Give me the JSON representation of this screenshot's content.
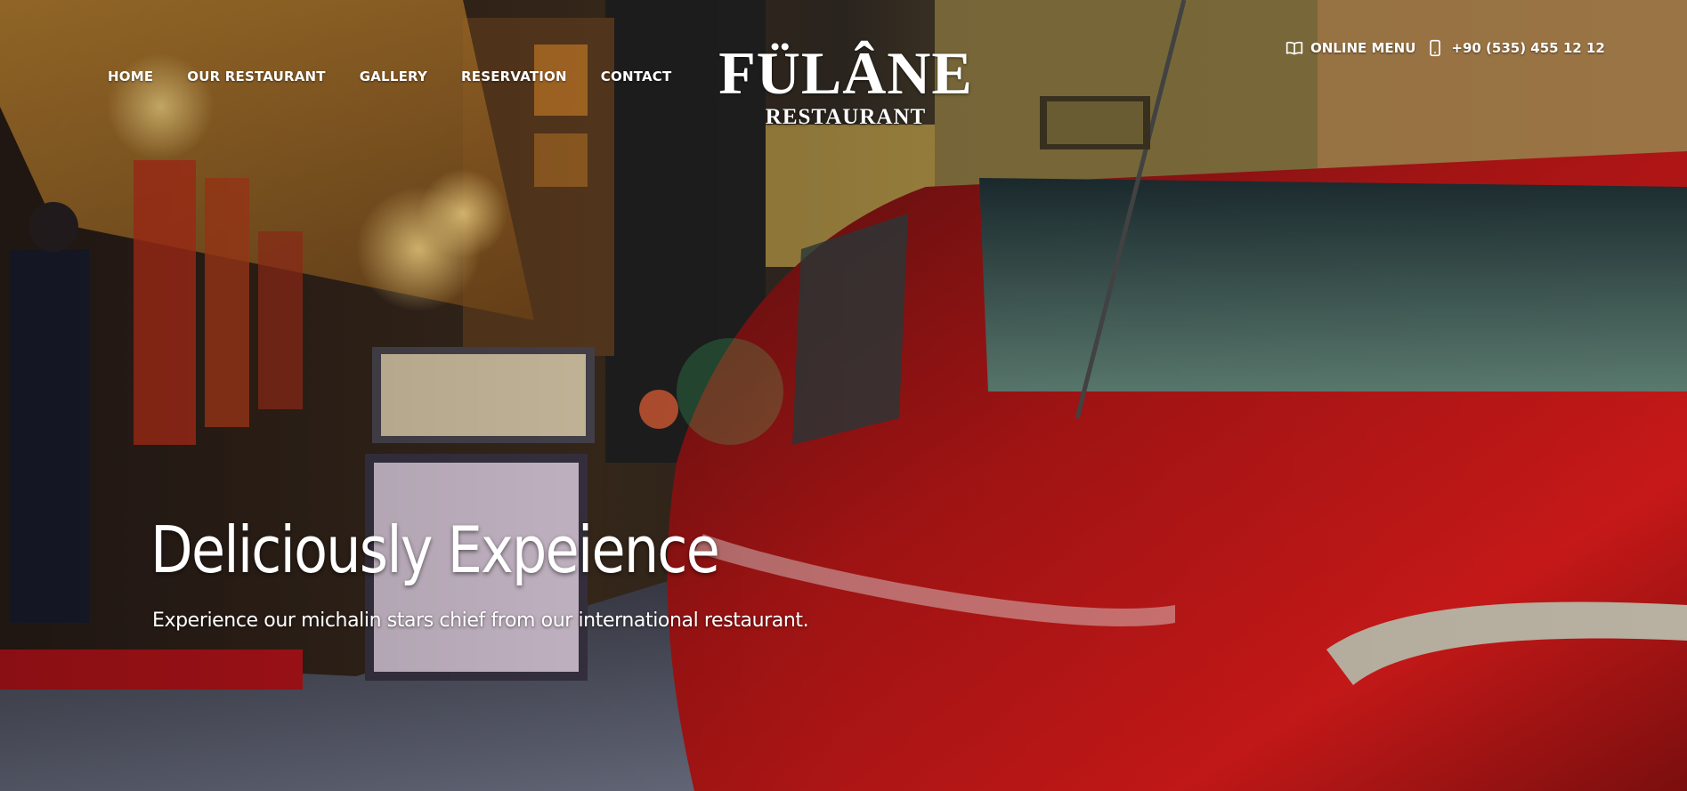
{
  "nav": {
    "items": [
      {
        "label": "HOME"
      },
      {
        "label": "OUR RESTAURANT"
      },
      {
        "label": "GALLERY"
      },
      {
        "label": "RESERVATION"
      },
      {
        "label": "CONTACT"
      }
    ]
  },
  "logo": {
    "name": "FÜLÂNE",
    "subtitle": "RESTAURANT"
  },
  "top_right": {
    "menu_label": "ONLINE MENU",
    "menu_icon": "book-open-icon",
    "phone": "+90 (535) 455 12 12",
    "phone_icon": "mobile-phone-icon"
  },
  "hero": {
    "title": "Deliciously Expeience",
    "subtitle": "Experience our michalin stars chief from our international restaurant."
  },
  "colors": {
    "text": "#ffffff",
    "car_red": "#a51414",
    "lights_amber": "#f2a93b"
  }
}
